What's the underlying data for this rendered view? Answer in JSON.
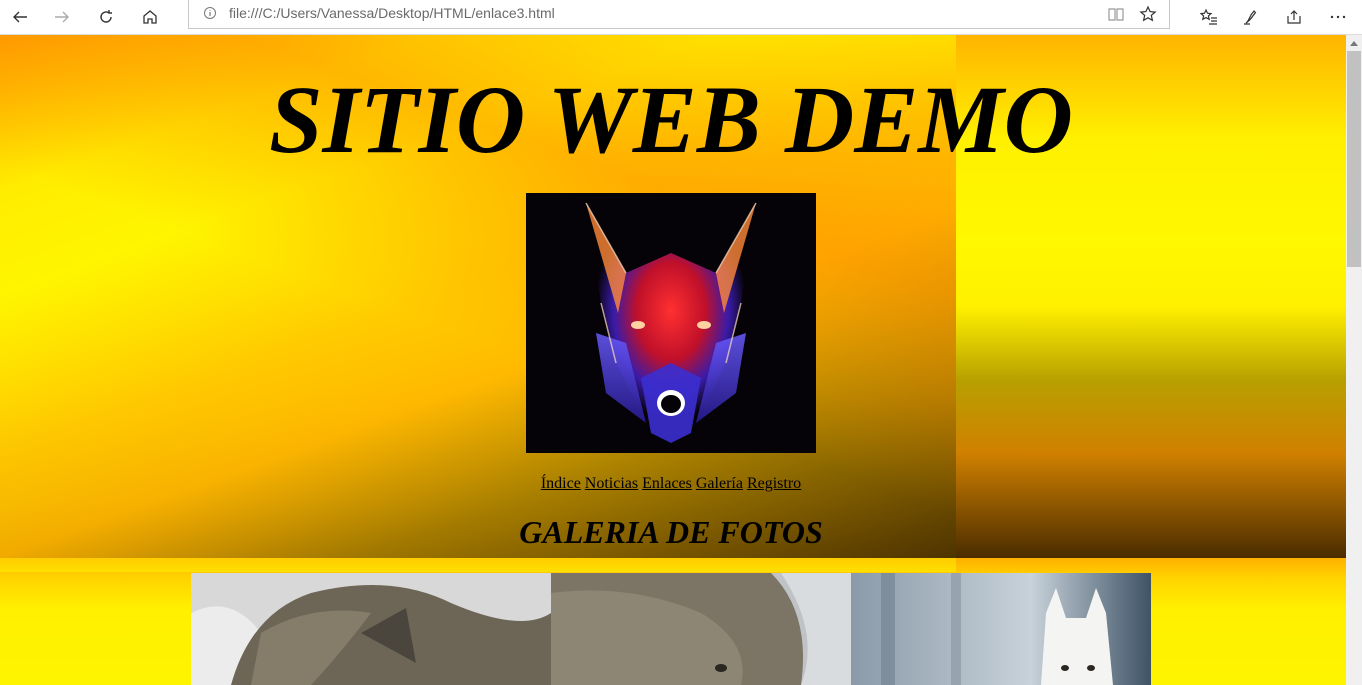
{
  "browser": {
    "url": "file:///C:/Users/Vanessa/Desktop/HTML/enlace3.html",
    "nav_icons": [
      "back-arrow-icon",
      "forward-arrow-icon",
      "refresh-icon",
      "home-icon"
    ],
    "address_icons": [
      "info-icon",
      "reading-view-icon",
      "favorite-star-icon"
    ],
    "right_icons": [
      "favorites-list-icon",
      "pen-icon",
      "share-icon",
      "more-icon"
    ]
  },
  "page": {
    "title": "SITIO WEB DEMO",
    "nav_links": [
      "Índice",
      "Noticias",
      "Enlaces",
      "Galería",
      "Registro"
    ],
    "gallery_heading": "GALERIA DE FOTOS"
  },
  "colors": {
    "background_yellow": "#fff200",
    "background_orange": "#ffb000",
    "text": "#000000"
  }
}
